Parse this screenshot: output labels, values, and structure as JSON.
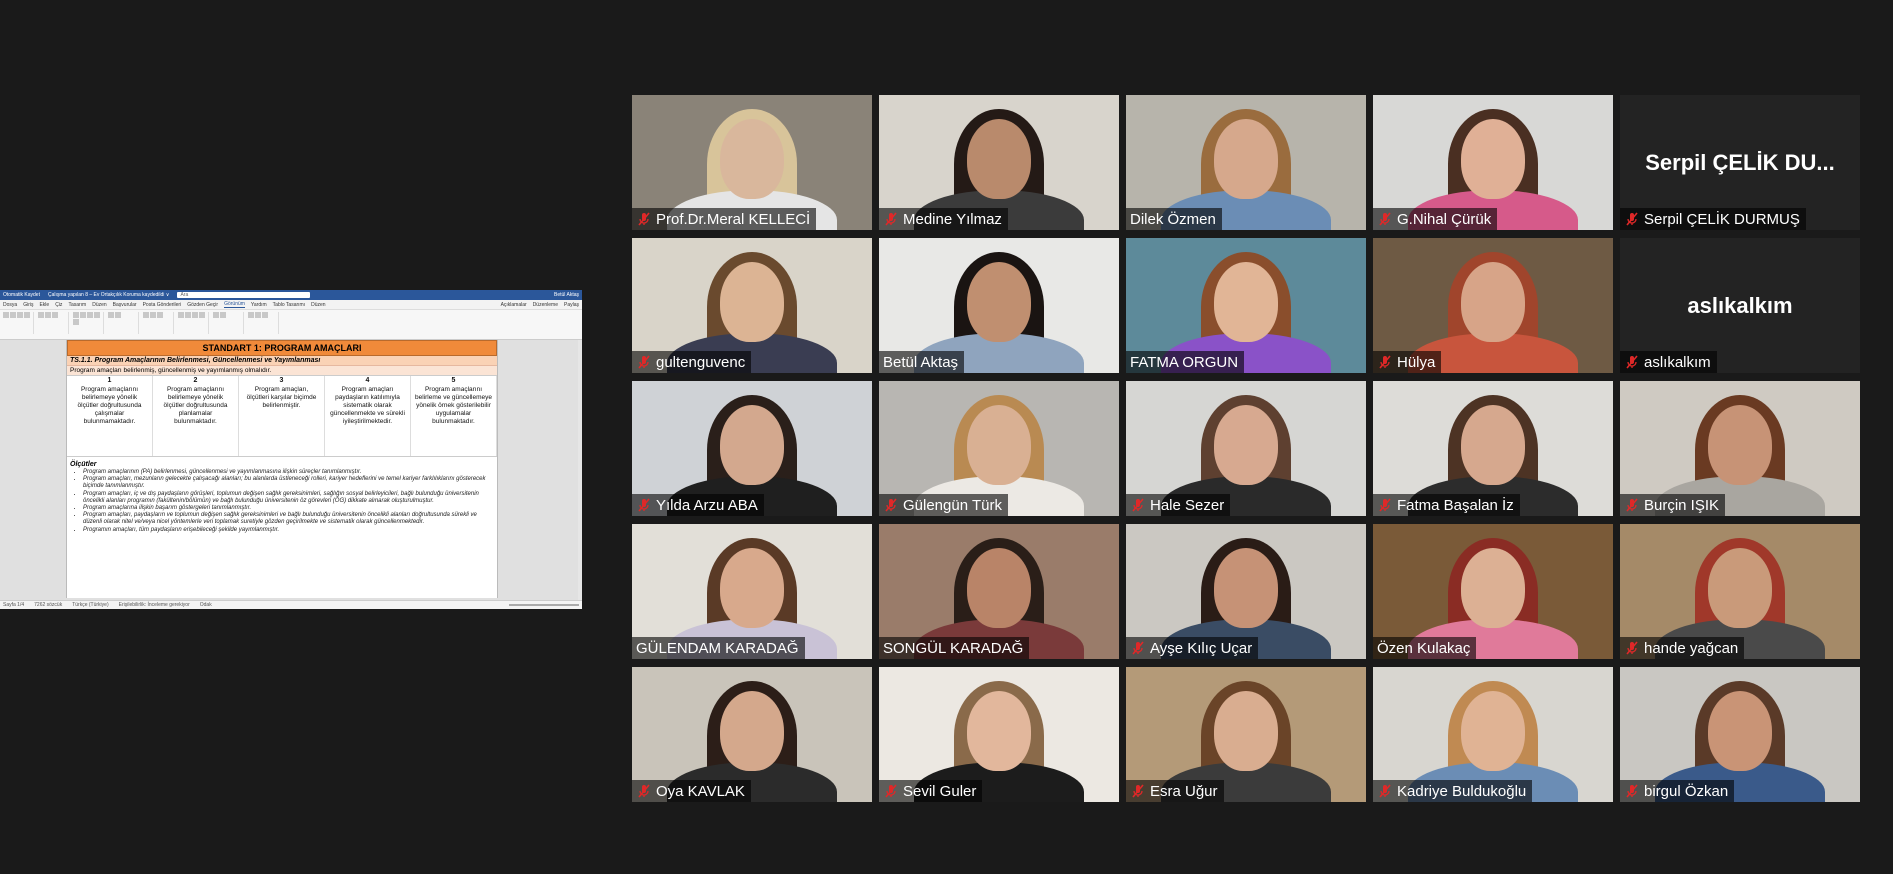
{
  "doc_window": {
    "title_bar": {
      "left": "Otomatik Kaydet",
      "doc_name": "Çalışma yapılan 8 – Ev Ortakçılık Koruma kaydedildi ∨",
      "search": "Ara",
      "user": "Betül Aktaş"
    },
    "menu": [
      "Dosya",
      "Giriş",
      "Ekle",
      "Çiz",
      "Tasarım",
      "Düzen",
      "Başvurular",
      "Posta Gönderileri",
      "Gözden Geçir",
      "Görünüm",
      "Yardım",
      "Tablo Tasarımı",
      "Düzen"
    ],
    "menu_active": "Görünüm",
    "menu_right": [
      "Açıklamalar",
      "Düzenleme",
      "Paylaş"
    ],
    "page": {
      "standard_title": "STANDART 1: PROGRAM AMAÇLARI",
      "ts_title": "TS.1.1. Program Amaçlarının Belirlenmesi, Güncellenmesi ve Yayımlanması",
      "ts_subtitle": "Program amaçları belirlenmiş, güncellenmiş ve yayımlanmış olmalıdır.",
      "scale": [
        {
          "num": "1",
          "text": "Program amaçlarını belirlemeye yönelik ölçütler doğrultusunda çalışmalar bulunmamaktadır."
        },
        {
          "num": "2",
          "text": "Program amaçlarını belirlemeye yönelik ölçütler doğrultusunda planlamalar bulunmaktadır."
        },
        {
          "num": "3",
          "text": "Program amaçları, ölçütleri karşılar biçimde belirlenmiştir."
        },
        {
          "num": "4",
          "text": "Program amaçları paydaşların katılımıyla sistematik olarak güncellenmekte ve sürekli iyileştirilmektedir."
        },
        {
          "num": "5",
          "text": "Program amaçlarını belirleme ve güncellemeye yönelik örnek gösterilebilir uygulamalar bulunmaktadır."
        }
      ],
      "olcutler_title": "Ölçütler",
      "bullets": [
        "Program amaçlarının (PA) belirlenmesi, güncellenmesi ve yayımlanmasına ilişkin süreçler tanımlanmıştır.",
        "Program amaçları, mezunların gelecekte çalışacağı alanları; bu alanlarda üstleneceği rolleri, kariyer hedeflerini ve temel kariyer farklılıklarını gösterecek biçimde tanımlanmıştır.",
        "Program amaçları, iç ve dış paydaşların görüşleri, toplumun değişen sağlık gereksinimleri, sağlığın sosyal belirleyicileri, bağlı bulunduğu üniversitenin öncelikli alanları programın (fakültenin/bölümün) ve bağlı bulunduğu üniversitenin öz görevleri (ÖG) dikkate alınarak oluşturulmuştur.",
        "Program amaçlarına ilişkin başarım göstergeleri tanımlanmıştır.",
        "Program amaçları, paydaşların ve toplumun değişen sağlık gereksinimleri ve bağlı bulunduğu üniversitenin öncelikli alanları doğrultusunda sürekli ve düzenli olarak nitel ve/veya nicel yöntemlerle veri toplamak suretiyle gözden geçirilmekte ve sistematik olarak güncellenmektedir.",
        "Programın amaçları, tüm paydaşların erişebileceği şekilde yayımlanmıştır."
      ]
    },
    "status": {
      "page": "Sayfa 1/4",
      "words": "7262 sözcük",
      "lang": "Türkçe (Türkiye)",
      "a11y": "Erişilebilirlik: İnceleme gerekiyor",
      "focus": "Odak"
    }
  },
  "participants": [
    {
      "name": "Prof.Dr.Meral KELLECİ",
      "muted": true,
      "bg": "#8a8378",
      "skin": "#d9b79c",
      "hair": "#d8c49a",
      "top": "#e5e5e5"
    },
    {
      "name": "Medine Yılmaz",
      "muted": true,
      "bg": "#d8d4cc",
      "skin": "#b98a6c",
      "hair": "#241a16",
      "top": "#3b3b3b"
    },
    {
      "name": "Dilek Özmen",
      "muted": false,
      "bg": "#b7b4ab",
      "skin": "#d6a88c",
      "hair": "#9a6c3e",
      "top": "#6b8db5"
    },
    {
      "name": "G.Nihal Çürük",
      "muted": true,
      "bg": "#d8d8d6",
      "skin": "#e0b096",
      "hair": "#4a2f22",
      "top": "#d65a8a"
    },
    {
      "name": "Serpil ÇELİK DURMUŞ",
      "muted": true,
      "initial": "Serpil ÇELİK DU...",
      "bg": "#232323"
    },
    {
      "name": "gultenguvenc",
      "muted": true,
      "bg": "#d9d4c9",
      "skin": "#dcb494",
      "hair": "#6a4a2e",
      "top": "#3a3d52"
    },
    {
      "name": "Betül Aktaş",
      "muted": false,
      "talking": true,
      "bg": "#e8e8e6",
      "skin": "#c08f70",
      "hair": "#1a1412",
      "top": "#8fa4be"
    },
    {
      "name": "FATMA ORGUN",
      "muted": false,
      "bg": "#5d8a9a",
      "skin": "#e1b596",
      "hair": "#8a4e2c",
      "top": "#8a52c8"
    },
    {
      "name": "Hülya",
      "muted": true,
      "bg": "#6e5a44",
      "skin": "#d7a488",
      "hair": "#a0452c",
      "top": "#c8553d"
    },
    {
      "name": "aslıkalkım",
      "muted": true,
      "initial": "aslıkalkım",
      "bg": "#232323"
    },
    {
      "name": "Yılda Arzu ABA",
      "muted": true,
      "bg": "#cfd2d6",
      "skin": "#d3a88e",
      "hair": "#2a1f1a",
      "top": "#1f1f1f"
    },
    {
      "name": "Gülengün Türk",
      "muted": true,
      "bg": "#b8b6b2",
      "skin": "#d9b093",
      "hair": "#b98a52",
      "top": "#ece9e4"
    },
    {
      "name": "Hale Sezer",
      "muted": true,
      "bg": "#d6d6d3",
      "skin": "#d7a990",
      "hair": "#5e4030",
      "top": "#2a2a2a"
    },
    {
      "name": "Fatma Başalan İz",
      "muted": true,
      "bg": "#dddcd8",
      "skin": "#d6a88e",
      "hair": "#4d3324",
      "top": "#2c2c2c"
    },
    {
      "name": "Burçin IŞIK",
      "muted": true,
      "bg": "#cfcac2",
      "skin": "#c79376",
      "hair": "#6a3a22",
      "top": "#a9a6a0"
    },
    {
      "name": "GÜLENDAM KARADAĞ",
      "muted": false,
      "bg": "#e2dfd8",
      "skin": "#d8a98c",
      "hair": "#5a3a26",
      "top": "#c9c2d6"
    },
    {
      "name": "SONGÜL KARADAĞ",
      "muted": false,
      "bg": "#9a7c6a",
      "skin": "#b98468",
      "hair": "#2a1e18",
      "top": "#7a3a3a"
    },
    {
      "name": "Ayşe Kılıç Uçar",
      "muted": true,
      "bg": "#cbc8c2",
      "skin": "#c69276",
      "hair": "#2a1c16",
      "top": "#3a4c64"
    },
    {
      "name": "Özen Kulakaç",
      "muted": false,
      "bg": "#7a5a38",
      "skin": "#dcb094",
      "hair": "#8a2c24",
      "top": "#e07a9a"
    },
    {
      "name": "hande yağcan",
      "muted": true,
      "bg": "#a58a68",
      "skin": "#c99a7a",
      "hair": "#a0382a",
      "top": "#4a4a4a"
    },
    {
      "name": "Oya KAVLAK",
      "muted": true,
      "bg": "#c9c4ba",
      "skin": "#d4a88c",
      "hair": "#2c1e18",
      "top": "#2b2b2b"
    },
    {
      "name": "Sevil Guler",
      "muted": true,
      "bg": "#ece8e2",
      "skin": "#e2b79c",
      "hair": "#8a6a4a",
      "top": "#1c1c1c"
    },
    {
      "name": "Esra Uğur",
      "muted": true,
      "bg": "#b49a78",
      "skin": "#d9ad90",
      "hair": "#6a4428",
      "top": "#3b3b3b"
    },
    {
      "name": "Kadriye Buldukoğlu",
      "muted": true,
      "bg": "#d8d6d0",
      "skin": "#e0b394",
      "hair": "#c08a52",
      "top": "#6b8db5"
    },
    {
      "name": "birgul Özkan",
      "muted": true,
      "bg": "#c9c7c2",
      "skin": "#c99476",
      "hair": "#5a3a28",
      "top": "#3a5a8a"
    }
  ],
  "colors": {
    "talking_border": "#f2e33a",
    "mute_icon": "#e02828",
    "meeting_bg": "#1a1a1a",
    "std_header": "#f08a3a"
  }
}
